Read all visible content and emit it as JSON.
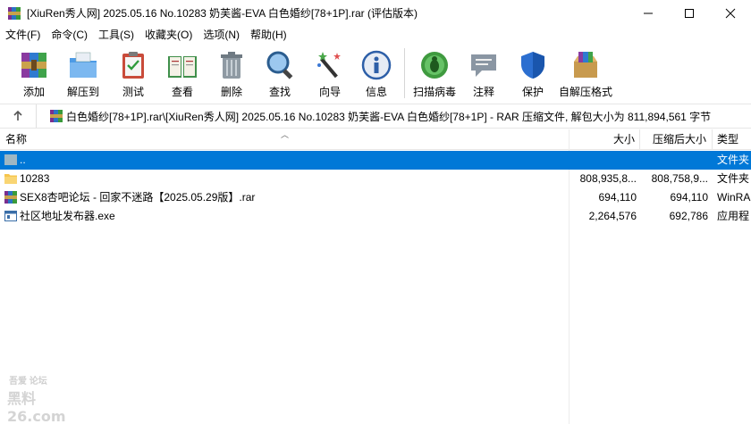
{
  "window": {
    "title": "[XiuRen秀人网] 2025.05.16 No.10283 奶芙酱-EVA 白色婚纱[78+1P].rar (评估版本)"
  },
  "menu": [
    "文件(F)",
    "命令(C)",
    "工具(S)",
    "收藏夹(O)",
    "选项(N)",
    "帮助(H)"
  ],
  "toolbar": {
    "buttons": [
      {
        "label": "添加",
        "icon": "add-archive-icon"
      },
      {
        "label": "解压到",
        "icon": "extract-to-icon"
      },
      {
        "label": "测试",
        "icon": "test-icon"
      },
      {
        "label": "查看",
        "icon": "view-book-icon"
      },
      {
        "label": "删除",
        "icon": "trash-icon"
      },
      {
        "label": "查找",
        "icon": "magnifier-icon"
      },
      {
        "label": "向导",
        "icon": "wizard-wand-icon"
      },
      {
        "label": "信息",
        "icon": "info-icon"
      },
      {
        "label": "扫描病毒",
        "icon": "virus-scan-icon"
      },
      {
        "label": "注释",
        "icon": "comment-icon"
      },
      {
        "label": "保护",
        "icon": "shield-icon"
      },
      {
        "label": "自解压格式",
        "icon": "sfx-box-icon"
      }
    ]
  },
  "address": {
    "path": "白色婚纱[78+1P].rar\\[XiuRen秀人网] 2025.05.16 No.10283 奶芙酱-EVA 白色婚纱[78+1P] - RAR 压缩文件, 解包大小为 811,894,561 字节"
  },
  "columns": {
    "name": "名称",
    "size": "大小",
    "packed": "压缩后大小",
    "type": "类型"
  },
  "rows": [
    {
      "name": "..",
      "size": "",
      "packed": "",
      "type": "文件夹",
      "icon": "parent-folder-icon",
      "selected": true
    },
    {
      "name": "10283",
      "size": "808,935,8...",
      "packed": "808,758,9...",
      "type": "文件夹",
      "icon": "folder-icon",
      "selected": false
    },
    {
      "name": "SEX8杏吧论坛 - 回家不迷路【2025.05.29版】.rar",
      "size": "694,110",
      "packed": "694,110",
      "type": "WinRA",
      "icon": "rar-file-icon",
      "selected": false
    },
    {
      "name": "社区地址发布器.exe",
      "size": "2,264,576",
      "packed": "692,786",
      "type": "应用程",
      "icon": "exe-file-icon",
      "selected": false
    }
  ],
  "watermark": {
    "line1": "吾爱  论坛",
    "line2": "黑料26.com"
  },
  "colors": {
    "selection": "#0078d7",
    "folder": "#f6c54d"
  }
}
